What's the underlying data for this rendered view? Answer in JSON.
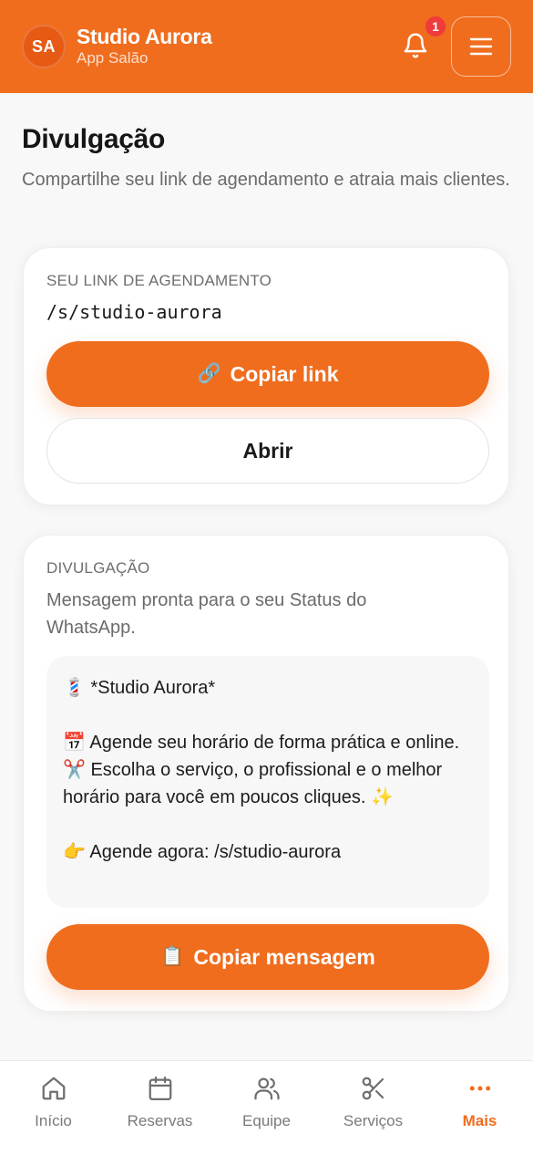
{
  "header": {
    "avatar_initials": "SA",
    "business_name": "Studio Aurora",
    "app_subtitle": "App Salão",
    "notification_count": "1",
    "bell_icon": "bell-icon",
    "menu_icon": "hamburger-menu-icon",
    "background_color": "#f06d1e"
  },
  "page": {
    "title": "Divulgação",
    "subtitle": "Compartilhe seu link de agendamento e atraia mais clientes."
  },
  "link_card": {
    "label": "SEU LINK DE AGENDAMENTO",
    "link": "/s/studio-aurora",
    "copy_button": {
      "icon": "🔗",
      "label": "Copiar link"
    },
    "open_button": {
      "label": "Abrir"
    }
  },
  "promo_card": {
    "label": "DIVULGAÇÃO",
    "description": "Mensagem pronta para o seu Status do WhatsApp.",
    "message_lines": [
      "💈 *Studio Aurora*",
      "",
      "📅 Agende seu horário de forma prática e online. ✂️ Escolha o serviço, o profissional e o melhor horário para você em poucos cliques. ✨",
      "",
      "👉 Agende agora: /s/studio-aurora"
    ],
    "copy_button": {
      "icon": "📋",
      "label": "Copiar mensagem"
    }
  },
  "bottom_nav": {
    "active_color": "#f06d1e",
    "items": [
      {
        "label": "Início",
        "icon": "home-icon",
        "active": false
      },
      {
        "label": "Reservas",
        "icon": "calendar-icon",
        "active": false
      },
      {
        "label": "Equipe",
        "icon": "users-icon",
        "active": false
      },
      {
        "label": "Serviços",
        "icon": "scissors-icon",
        "active": false
      },
      {
        "label": "Mais",
        "icon": "more-dots-icon",
        "active": true
      }
    ]
  }
}
